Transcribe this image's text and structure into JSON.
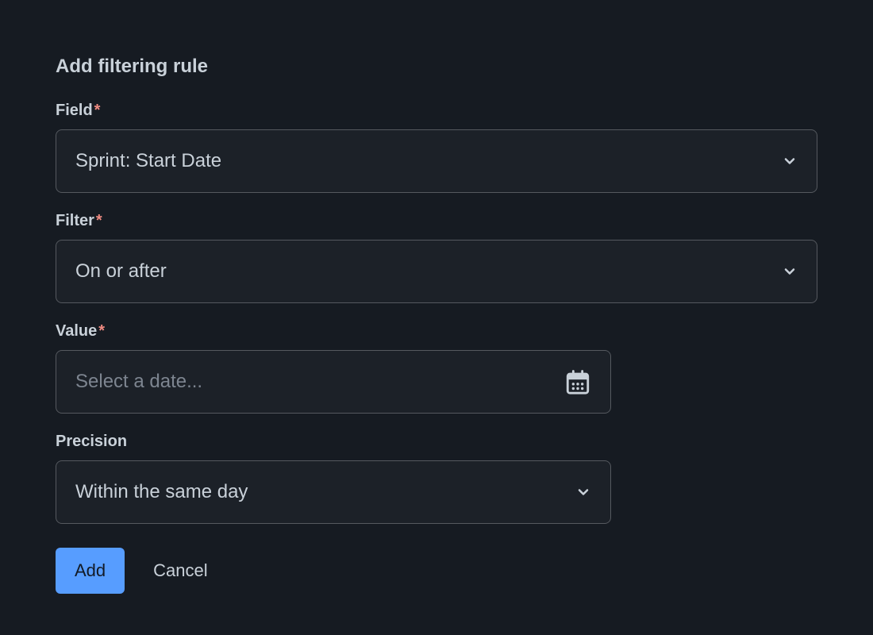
{
  "form": {
    "title": "Add filtering rule",
    "fields": {
      "field": {
        "label": "Field",
        "required": true,
        "value": "Sprint: Start Date"
      },
      "filter": {
        "label": "Filter",
        "required": true,
        "value": "On or after"
      },
      "value": {
        "label": "Value",
        "required": true,
        "placeholder": "Select a date..."
      },
      "precision": {
        "label": "Precision",
        "required": false,
        "value": "Within the same day"
      }
    },
    "buttons": {
      "add": "Add",
      "cancel": "Cancel"
    }
  }
}
